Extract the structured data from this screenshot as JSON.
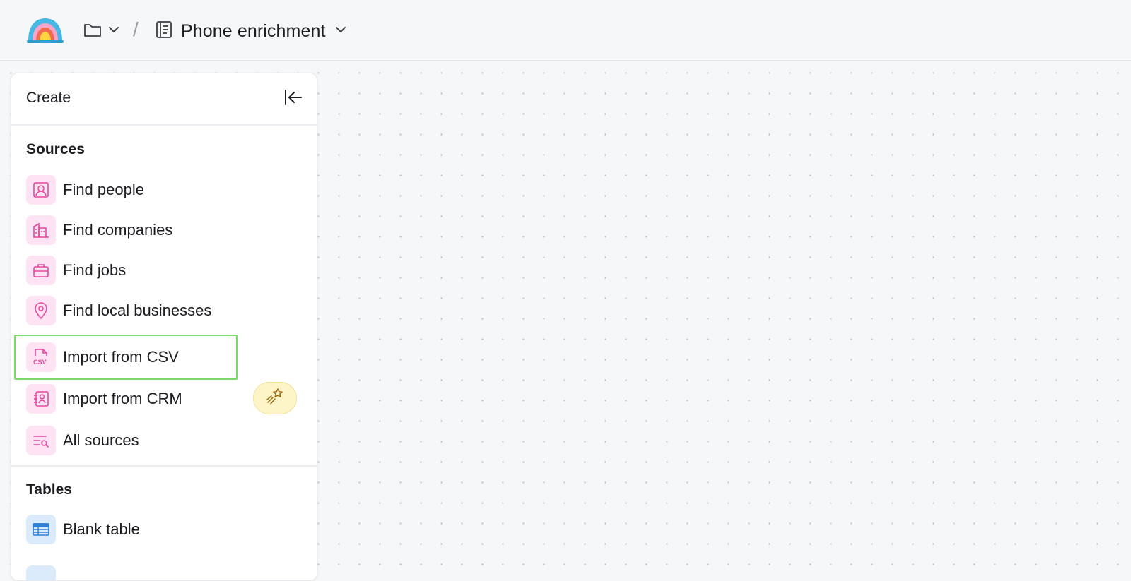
{
  "header": {
    "document_title": "Phone enrichment",
    "separator": "/"
  },
  "panel": {
    "title": "Create",
    "sections": {
      "sources": {
        "title": "Sources",
        "items": [
          {
            "label": "Find people",
            "icon": "person-icon"
          },
          {
            "label": "Find companies",
            "icon": "building-icon"
          },
          {
            "label": "Find jobs",
            "icon": "briefcase-icon"
          },
          {
            "label": "Find local businesses",
            "icon": "map-pin-icon"
          },
          {
            "label": "Import from CSV",
            "icon": "csv-file-icon"
          },
          {
            "label": "Import from CRM",
            "icon": "contact-book-icon"
          },
          {
            "label": "All sources",
            "icon": "list-search-icon"
          }
        ]
      },
      "tables": {
        "title": "Tables",
        "items": [
          {
            "label": "Blank table",
            "icon": "table-icon"
          }
        ]
      }
    }
  },
  "colors": {
    "accent_pink": "#e8489f",
    "pink_bg": "#fde3f3",
    "blue_accent": "#2f7fd6",
    "highlight_green": "#7dd86c"
  }
}
